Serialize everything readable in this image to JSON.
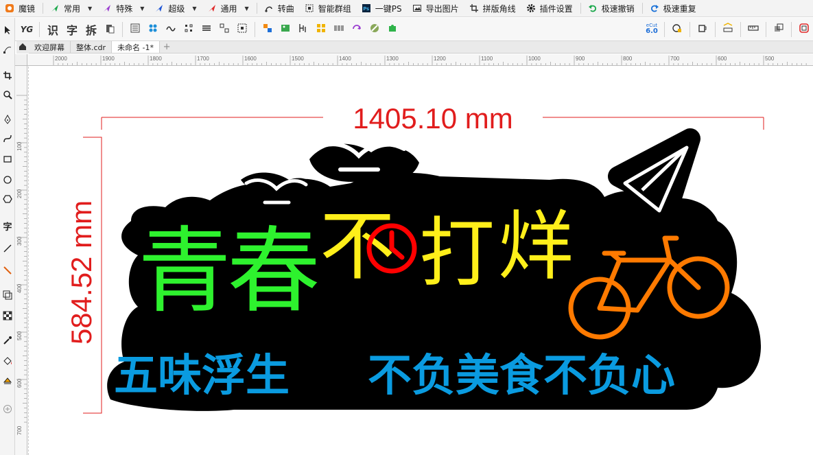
{
  "menubar": {
    "app_name": "魔镜",
    "items": [
      {
        "label": "常用",
        "icon": "green-arrow-icon"
      },
      {
        "label": "特殊",
        "icon": "purple-arrow-icon"
      },
      {
        "label": "超级",
        "icon": "blue-arrow-icon"
      },
      {
        "label": "通用",
        "icon": "red-arrow-icon"
      }
    ],
    "actions": [
      {
        "label": "转曲",
        "icon": "convert-curve-icon"
      },
      {
        "label": "智能群组",
        "icon": "smart-group-icon"
      },
      {
        "label": "一键PS",
        "icon": "ps-icon"
      },
      {
        "label": "导出图片",
        "icon": "export-image-icon"
      },
      {
        "label": "拼版角线",
        "icon": "crop-marks-icon"
      },
      {
        "label": "插件设置",
        "icon": "gear-icon"
      },
      {
        "label": "极速撤销",
        "icon": "undo-icon"
      },
      {
        "label": "极速重复",
        "icon": "redo-icon"
      }
    ]
  },
  "toolbar2": {
    "text_buttons": [
      "识",
      "字",
      "拆"
    ],
    "logo": "YG",
    "ecut_label": "eCut",
    "ecut_version": "6.0"
  },
  "tabs": [
    {
      "label": "欢迎屏幕"
    },
    {
      "label": "整体.cdr"
    },
    {
      "label": "未命名 -1*"
    }
  ],
  "ruler": {
    "h_labels": [
      "2000",
      "1900",
      "1800",
      "1700",
      "1600",
      "1500",
      "1400",
      "1300",
      "1200",
      "1100",
      "1000",
      "900",
      "800",
      "700",
      "600",
      "500"
    ],
    "v_labels": [
      "100",
      "200",
      "300",
      "400",
      "500",
      "600",
      "700"
    ]
  },
  "artwork": {
    "width_dimension": "1405.10 mm",
    "height_dimension": "584.52 mm",
    "title_chars": [
      {
        "text": "青",
        "color": "#2ef22e"
      },
      {
        "text": "春",
        "color": "#2ef22e"
      },
      {
        "text": "不",
        "color": "#ffef1a"
      },
      {
        "text": "打",
        "color": "#ffef1a"
      },
      {
        "text": "烊",
        "color": "#ffef1a"
      }
    ],
    "subtitle_left": "五味浮生",
    "subtitle_right": "不负美食不负心",
    "colors": {
      "dimension": "#e11d1d",
      "green": "#2ef22e",
      "yellow": "#ffef1a",
      "red": "#ff0000",
      "orange": "#ff7a00",
      "blue": "#0a9be0",
      "white": "#ffffff",
      "background": "#000000"
    }
  }
}
